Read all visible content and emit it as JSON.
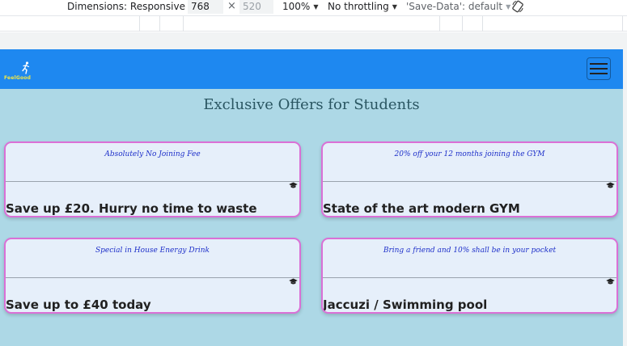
{
  "devtools": {
    "dimensions_label": "Dimensions: Responsive",
    "width_value": "768",
    "height_value": "520",
    "times": "×",
    "zoom": "100%",
    "throttling": "No throttling",
    "save_data": "'Save-Data': default"
  },
  "navbar": {
    "brand_text": "FeelGood",
    "accent_color": "#1e88f0",
    "brand_color": "#f4e842"
  },
  "page": {
    "title": "Exclusive Offers for Students",
    "background": "#add8e6"
  },
  "offers": [
    {
      "subtitle": "Absolutely No Joining Fee",
      "text": "Save up £20. Hurry no time to waste",
      "icon": "graduation-cap-icon"
    },
    {
      "subtitle": "20% off your 12 months joining the GYM",
      "text": "State of the art modern GYM",
      "icon": "graduation-cap-icon"
    },
    {
      "subtitle": "Special in House Energy Drink",
      "text": "Save up to £40 today",
      "icon": "graduation-cap-icon"
    },
    {
      "subtitle": "Bring a friend and 10% shall be in your pocket",
      "text": "Jaccuzi / Swimming pool",
      "icon": "graduation-cap-icon"
    }
  ]
}
